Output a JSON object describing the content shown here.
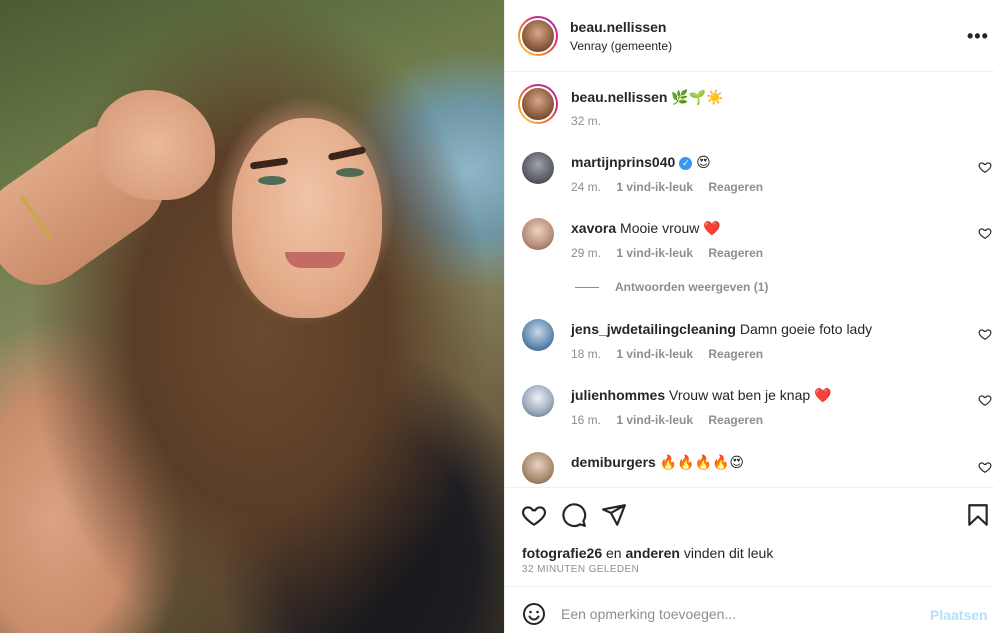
{
  "post": {
    "username": "beau.nellissen",
    "location": "Venray (gemeente)",
    "more_label": "•••"
  },
  "caption": {
    "username": "beau.nellissen",
    "text": "🌿🌱☀️",
    "time": "32 m."
  },
  "comments": [
    {
      "username": "martijnprins040",
      "verified": true,
      "text": "😍",
      "time": "24 m.",
      "likes": "1 vind-ik-leuk",
      "reply": "Reageren"
    },
    {
      "username": "xavora",
      "verified": false,
      "text": "Mooie vrouw ❤️",
      "time": "29 m.",
      "likes": "1 vind-ik-leuk",
      "reply": "Reageren"
    },
    {
      "username": "jens_jwdetailingcleaning",
      "verified": false,
      "text": "Damn goeie foto lady",
      "time": "18 m.",
      "likes": "1 vind-ik-leuk",
      "reply": "Reageren"
    },
    {
      "username": "julienhommes",
      "verified": false,
      "text": "Vrouw wat ben je knap ❤️",
      "time": "16 m.",
      "likes": "1 vind-ik-leuk",
      "reply": "Reageren"
    },
    {
      "username": "demiburgers",
      "verified": false,
      "text": "🔥🔥🔥🔥😍",
      "time": "",
      "likes": "",
      "reply": ""
    }
  ],
  "view_replies": "Antwoorden weergeven (1)",
  "likes_line": {
    "user": "fotografie26",
    "connector": "en",
    "others": "anderen",
    "suffix": "vinden dit leuk"
  },
  "posted_time": "32 MINUTEN GELEDEN",
  "add_comment": {
    "placeholder": "Een opmerking toevoegen...",
    "post_label": "Plaatsen"
  },
  "icons": {
    "like": "heart-icon",
    "comment": "comment-icon",
    "share": "share-icon",
    "save": "bookmark-icon",
    "emoji": "emoji-icon"
  },
  "colors": {
    "accent": "#3897f0",
    "post_button_disabled": "#b2dffc",
    "muted": "#8e8e8e",
    "text": "#262626",
    "heart": "#ed4956"
  }
}
